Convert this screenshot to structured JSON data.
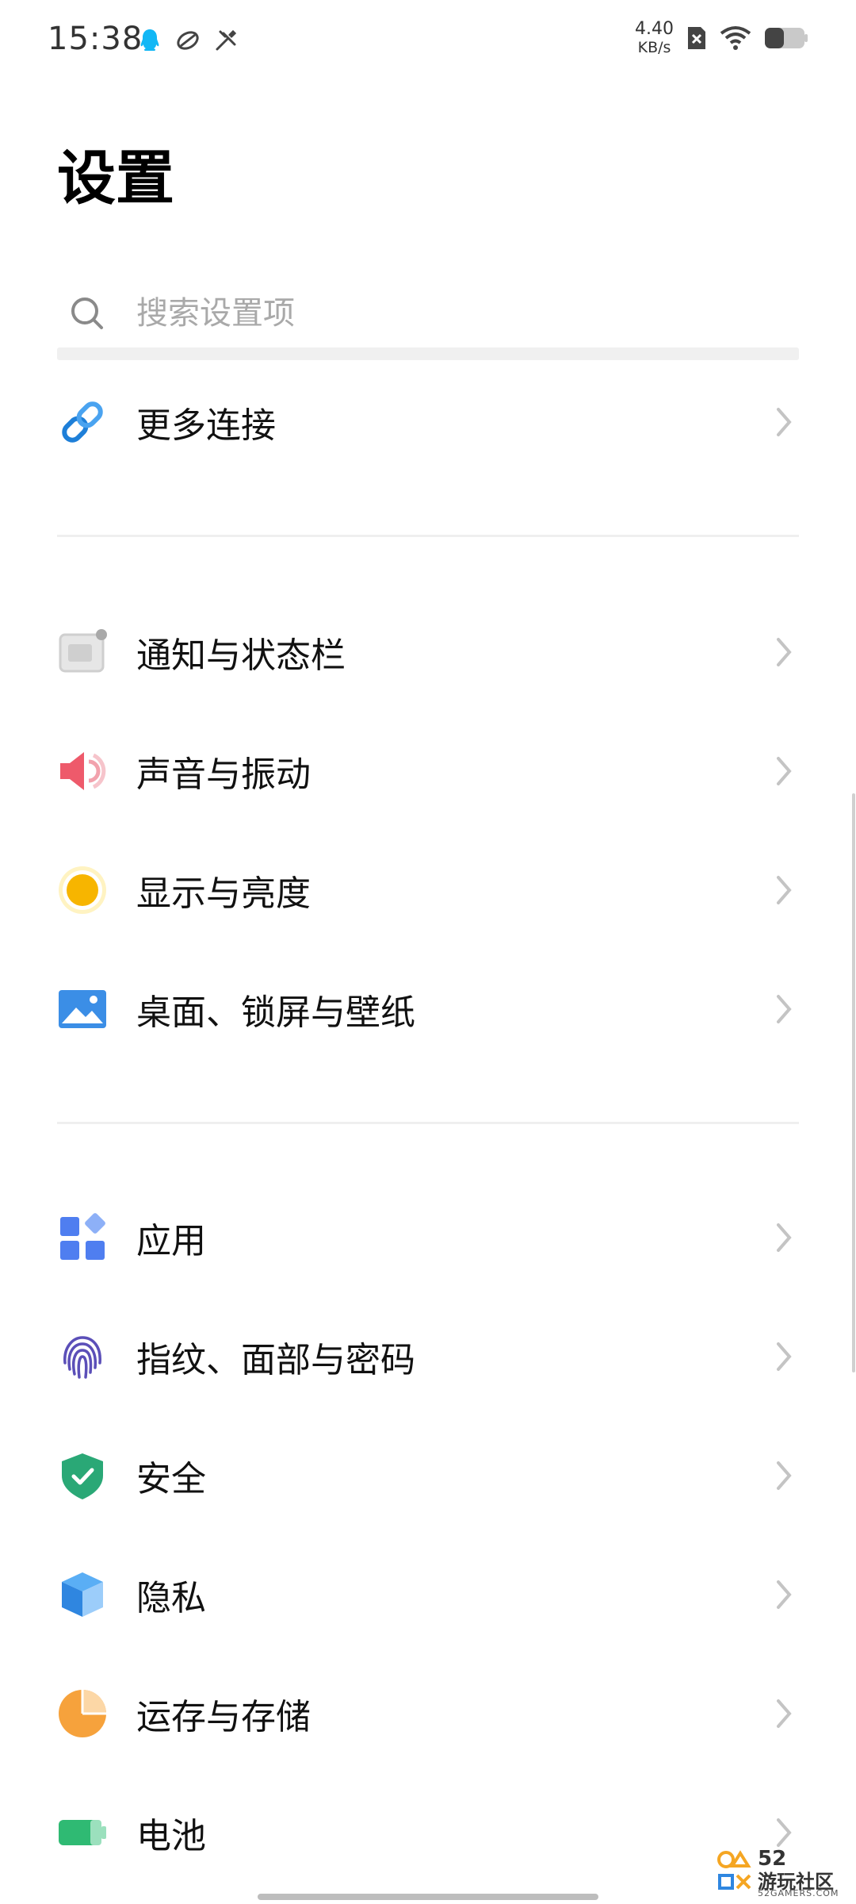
{
  "status_bar": {
    "time": "15:38",
    "net_speed_value": "4.40",
    "net_speed_unit": "KB/s",
    "icons": [
      "qq-icon",
      "game-icon",
      "tools-icon",
      "no-sim-icon",
      "wifi-icon",
      "battery-icon"
    ]
  },
  "header": {
    "title": "设置"
  },
  "search": {
    "placeholder": "搜索设置项"
  },
  "items": [
    {
      "label": "更多连接",
      "icon": "link-icon"
    },
    {
      "label": "通知与状态栏",
      "icon": "notification-icon"
    },
    {
      "label": "声音与振动",
      "icon": "speaker-icon"
    },
    {
      "label": "显示与亮度",
      "icon": "brightness-icon"
    },
    {
      "label": "桌面、锁屏与壁纸",
      "icon": "wallpaper-icon"
    },
    {
      "label": "应用",
      "icon": "apps-icon"
    },
    {
      "label": "指纹、面部与密码",
      "icon": "fingerprint-icon"
    },
    {
      "label": "安全",
      "icon": "shield-icon"
    },
    {
      "label": "隐私",
      "icon": "privacy-cube-icon"
    },
    {
      "label": "运存与存储",
      "icon": "storage-pie-icon"
    },
    {
      "label": "电池",
      "icon": "battery-icon"
    }
  ],
  "watermark": {
    "number": "52",
    "site": "游玩社区",
    "url": "52GAMERS.COM"
  },
  "colors": {
    "link": "#1e7fd8",
    "speaker": "#ee5a6b",
    "brightness": "#f7b500",
    "wallpaper": "#3b8ee6",
    "apps": "#4f7ef0",
    "fingerprint": "#5b4fb8",
    "shield": "#2aa876",
    "privacy": "#3d9af2",
    "storage": "#f6a23c",
    "battery": "#2fba73"
  }
}
